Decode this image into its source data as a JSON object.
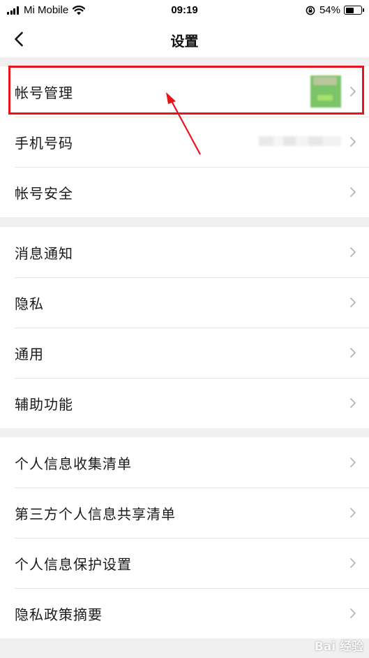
{
  "status_bar": {
    "carrier": "Mi Mobile",
    "time": "09:19",
    "battery": "54%",
    "battery_level": 0.54
  },
  "nav": {
    "title": "设置",
    "back_icon": "chevron-left-icon"
  },
  "groups": [
    {
      "items": [
        {
          "label": "帐号管理",
          "trailing": "avatar"
        },
        {
          "label": "手机号码",
          "trailing": "phone"
        },
        {
          "label": "帐号安全"
        }
      ]
    },
    {
      "items": [
        {
          "label": "消息通知"
        },
        {
          "label": "隐私"
        },
        {
          "label": "通用"
        },
        {
          "label": "辅助功能"
        }
      ]
    },
    {
      "items": [
        {
          "label": "个人信息收集清单"
        },
        {
          "label": "第三方个人信息共享清单"
        },
        {
          "label": "个人信息保护设置"
        },
        {
          "label": "隐私政策摘要"
        }
      ]
    }
  ],
  "colors": {
    "highlight": "#e8141b",
    "background": "#f0f0f0",
    "chevron": "#b5b5b5"
  },
  "watermark": "Bai 经验"
}
